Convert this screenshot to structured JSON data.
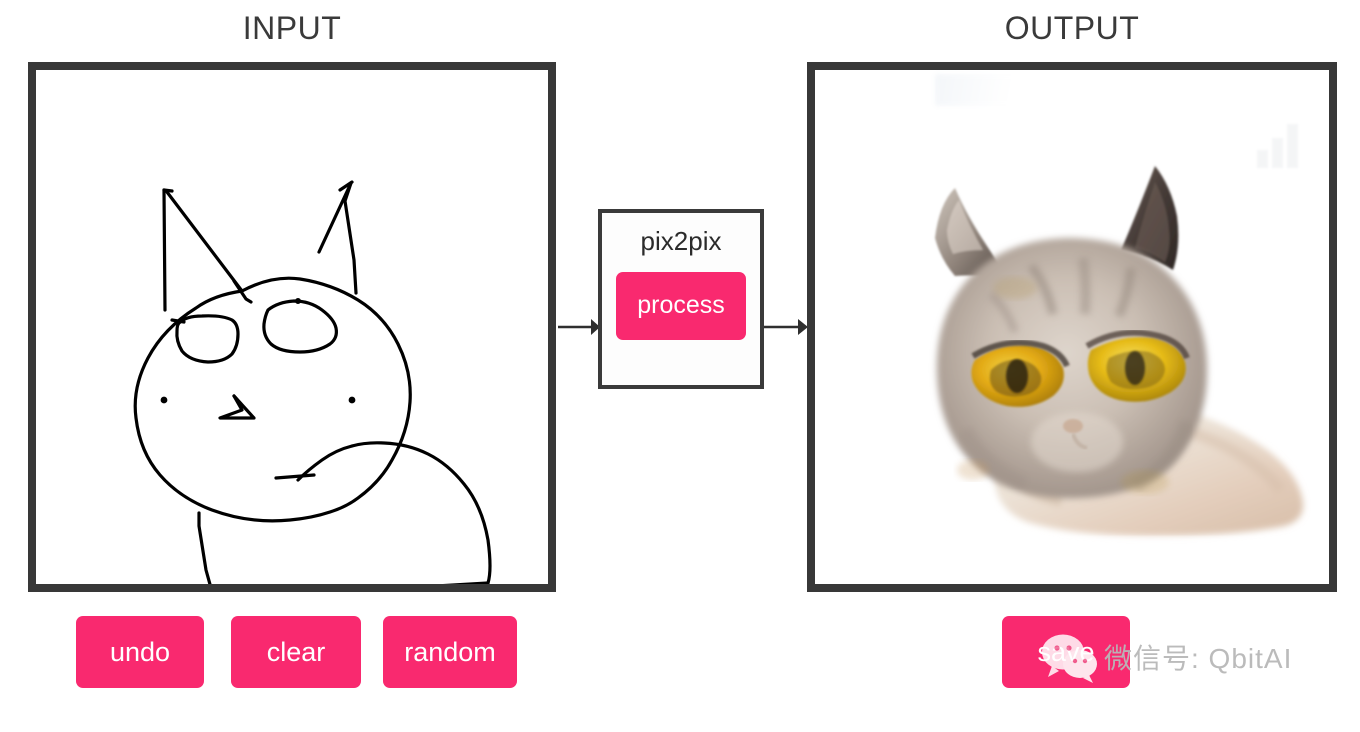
{
  "app": {
    "model_name": "pix2pix"
  },
  "columns": {
    "input_title": "INPUT",
    "output_title": "OUTPUT"
  },
  "module": {
    "label": "pix2pix",
    "process_label": "process"
  },
  "input_controls": {
    "undo_label": "undo",
    "clear_label": "clear",
    "random_label": "random"
  },
  "output_controls": {
    "save_label": "save"
  },
  "watermark": {
    "text": "微信号: QbitAI",
    "icon": "wechat-icon"
  },
  "colors": {
    "accent_pink": "#f9296f",
    "panel_border": "#383838",
    "title_text": "#3a3a3a",
    "canvas_background": "#ffffff",
    "stroke_black": "#000000"
  },
  "input_canvas": {
    "description": "hand-drawn black line sketch of a cat on white background",
    "stroke_color": "#000000",
    "stroke_width": 3
  },
  "output_canvas": {
    "description": "pix2pix generated photo-like cat face with yellow-green eyes and grey-cream fur on white background",
    "fur_colors": [
      "#cfc4bc",
      "#b4a79c",
      "#8d8179",
      "#e8e0d8"
    ],
    "eye_colors": [
      "#e8b213",
      "#f2d03a",
      "#9a7708"
    ],
    "ear_colors": [
      "#5a4d48",
      "#3d3430"
    ]
  }
}
